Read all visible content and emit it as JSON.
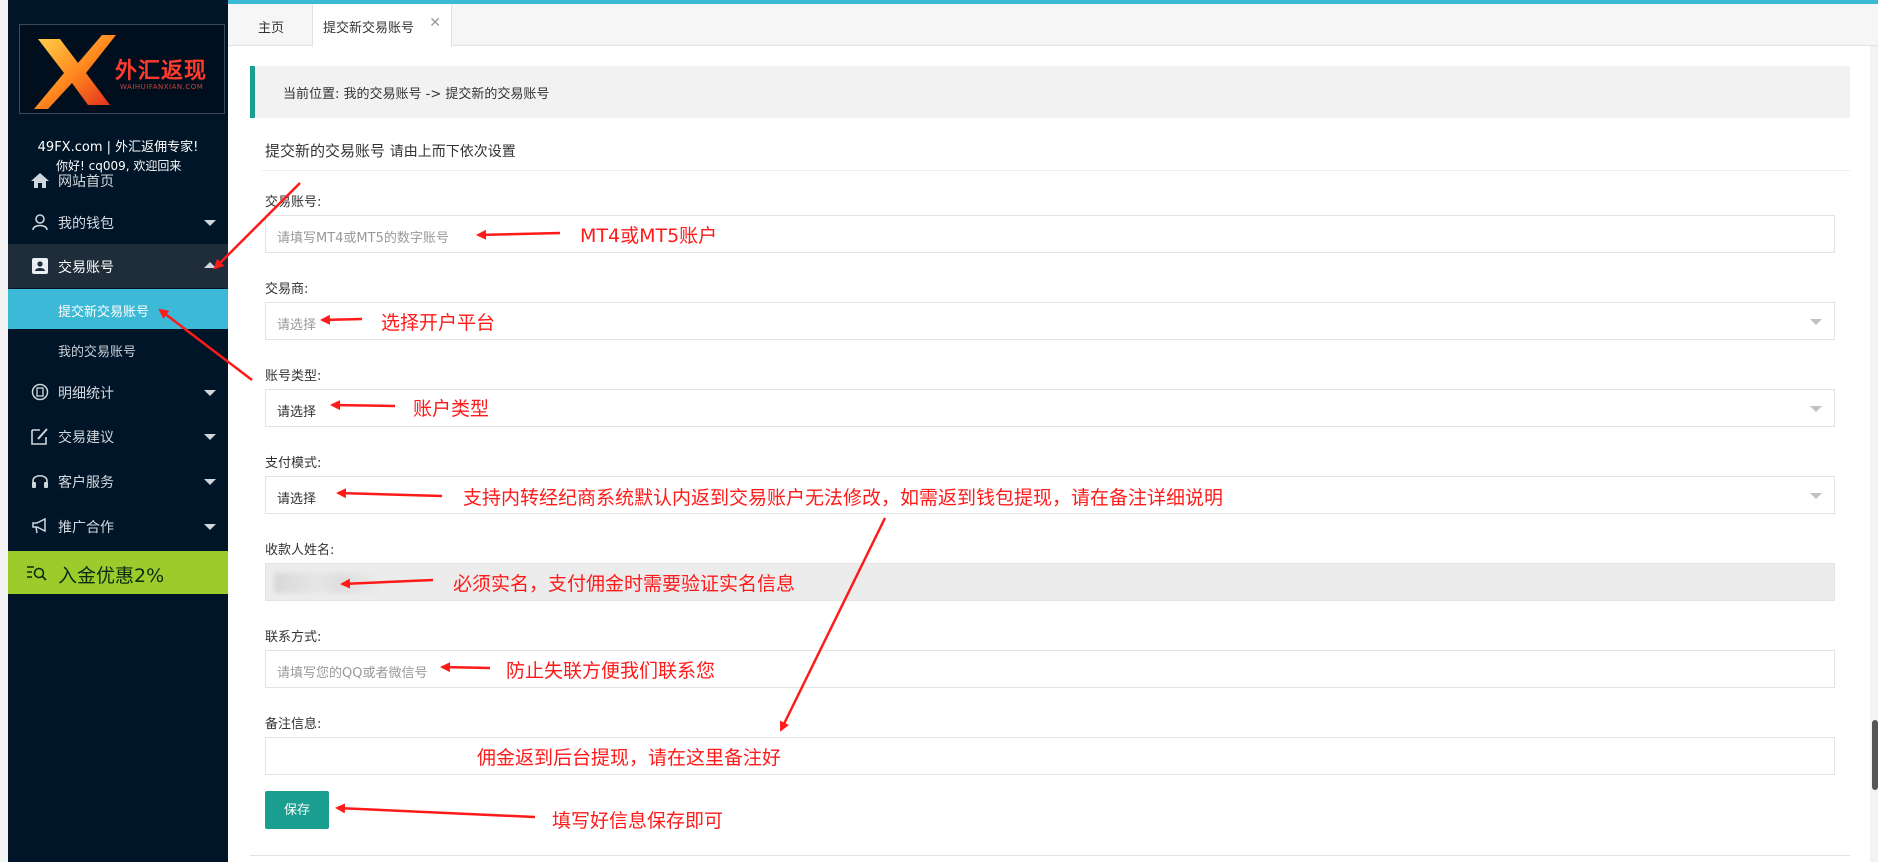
{
  "sidebar": {
    "logo": {
      "brand_cn": "外汇返现",
      "brand_en": "WAIHUIFANXIAN.COM"
    },
    "site_title": "49FX.com | 外汇返佣专家!",
    "greeting": "你好! cq009, 欢迎回来",
    "items": [
      {
        "label": "网站首页",
        "icon": "home-icon"
      },
      {
        "label": "我的钱包",
        "icon": "user-icon"
      },
      {
        "label": "交易账号",
        "icon": "account-card-icon",
        "expanded": true
      },
      {
        "label": "明细统计",
        "icon": "stats-icon"
      },
      {
        "label": "交易建议",
        "icon": "edit-icon"
      },
      {
        "label": "客户服务",
        "icon": "headset-icon"
      },
      {
        "label": "推广合作",
        "icon": "megaphone-icon"
      }
    ],
    "sub_items": [
      {
        "label": "提交新交易账号",
        "selected": true
      },
      {
        "label": "我的交易账号",
        "selected": false
      }
    ],
    "promo": {
      "label": "入金优惠2%",
      "icon": "list-search-icon"
    }
  },
  "tabs": [
    {
      "label": "主页"
    },
    {
      "label": "提交新交易账号",
      "closable": true
    }
  ],
  "breadcrumb": "当前位置:  我的交易账号 -> 提交新的交易账号",
  "section": {
    "title": "提交新的交易账号",
    "hint": "请由上而下依次设置"
  },
  "form": {
    "account": {
      "label": "交易账号:",
      "placeholder": "请填写MT4或MT5的数字账号"
    },
    "broker": {
      "label": "交易商:",
      "placeholder": "请选择"
    },
    "account_type": {
      "label": "账号类型:",
      "value": "请选择"
    },
    "pay_mode": {
      "label": "支付模式:",
      "value": "请选择"
    },
    "payee_name": {
      "label": "收款人姓名:",
      "value": ""
    },
    "contact": {
      "label": "联系方式:",
      "placeholder": "请填写您的QQ或者微信号"
    },
    "remark": {
      "label": "备注信息:",
      "value": ""
    },
    "save_label": "保存"
  },
  "annotations": {
    "account": "MT4或MT5账户",
    "broker": "选择开户平台",
    "account_type": "账户类型",
    "pay_mode": "支持内转经纪商系统默认内返到交易账户无法修改，如需返到钱包提现，请在备注详细说明",
    "payee_name": "必须实名，支付佣金时需要验证实名信息",
    "contact": "防止失联方便我们联系您",
    "remark": "佣金返到后台提现，请在这里备注好",
    "save": "填写好信息保存即可"
  },
  "colors": {
    "sidebar_bg": "#001528",
    "accent_cyan": "#3bb9d6",
    "accent_teal": "#1a9e8f",
    "promo_green": "#9ccc2c",
    "annotation_red": "#ff1a1a"
  }
}
